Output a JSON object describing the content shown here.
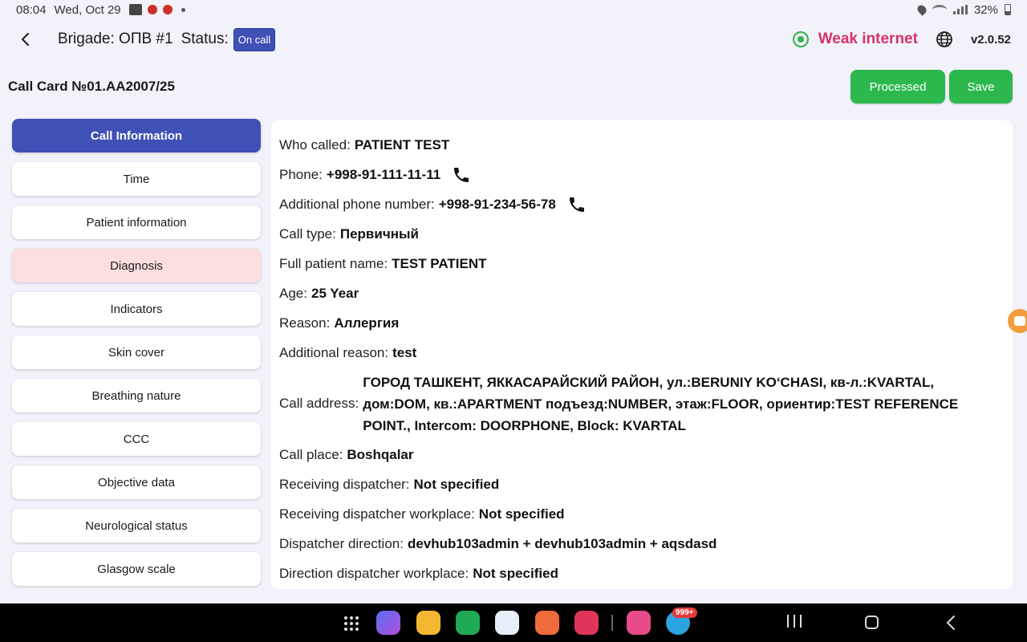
{
  "status_bar": {
    "time": "08:04",
    "date": "Wed, Oct 29",
    "battery": "32%"
  },
  "header": {
    "brigade": "Brigade: ОПВ #1",
    "status_label": "Status:",
    "status_badge": "On call",
    "network_status": "Weak internet",
    "version": "v2.0.52"
  },
  "card": {
    "title": "Call Card №01.AA2007/25",
    "processed_label": "Processed",
    "save_label": "Save"
  },
  "sidebar": {
    "items": [
      {
        "label": "Call Information"
      },
      {
        "label": "Time"
      },
      {
        "label": "Patient information"
      },
      {
        "label": "Diagnosis"
      },
      {
        "label": "Indicators"
      },
      {
        "label": "Skin cover"
      },
      {
        "label": "Breathing nature"
      },
      {
        "label": "CCC"
      },
      {
        "label": "Objective data"
      },
      {
        "label": "Neurological status"
      },
      {
        "label": "Glasgow scale"
      }
    ]
  },
  "details": {
    "who_called": {
      "label": "Who called:",
      "value": "PATIENT TEST"
    },
    "phone": {
      "label": "Phone:",
      "value": "+998-91-111-11-11"
    },
    "additional_phone": {
      "label": "Additional phone number:",
      "value": "+998-91-234-56-78"
    },
    "call_type": {
      "label": "Call type:",
      "value": "Первичный"
    },
    "full_name": {
      "label": "Full patient name:",
      "value": "TEST PATIENT"
    },
    "age": {
      "label": "Age:",
      "value": "25 Year"
    },
    "reason": {
      "label": "Reason:",
      "value": "Аллергия"
    },
    "additional_reason": {
      "label": "Additional reason:",
      "value": "test"
    },
    "call_address": {
      "label": "Call address:",
      "value": "ГОРОД  ТАШКЕНТ, ЯККАСАРАЙСКИЙ РАЙОН, ул.:BERUNIY KO‘CHASI, кв-л.:KVARTAL, дом:DOM, кв.:APARTMENT подъезд:NUMBER, этаж:FLOOR, ориентир:TEST REFERENCE POINT., Intercom: DOORPHONE, Block: KVARTAL"
    },
    "call_place": {
      "label": "Call place:",
      "value": "Boshqalar"
    },
    "receiving_dispatcher": {
      "label": "Receiving dispatcher:",
      "value": "Not specified"
    },
    "receiving_workplace": {
      "label": "Receiving dispatcher workplace:",
      "value": "Not specified"
    },
    "dispatcher_direction": {
      "label": "Dispatcher direction:",
      "value": "devhub103admin + devhub103admin + aqsdasd"
    },
    "direction_workplace": {
      "label": "Direction dispatcher workplace:",
      "value": "Not specified"
    }
  },
  "nav": {
    "telegram_badge": "999+"
  },
  "colors": {
    "accent": "#3f51b5",
    "success": "#2db84d",
    "warning_bg": "#fcdede",
    "network_text": "#d6336c"
  }
}
